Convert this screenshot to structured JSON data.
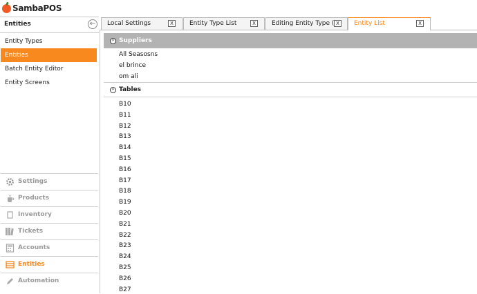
{
  "app": {
    "logo_text": "SambaPOS"
  },
  "sidebar": {
    "header_title": "Entities",
    "back_icon": "arrow-left-icon",
    "items": [
      {
        "label": "Entity Types",
        "active": false
      },
      {
        "label": "Entities",
        "active": true
      },
      {
        "label": "Batch Entity Editor",
        "active": false
      },
      {
        "label": "Entity Screens",
        "active": false
      }
    ],
    "nav": [
      {
        "label": "Settings",
        "icon": "gear-icon",
        "active": false
      },
      {
        "label": "Products",
        "icon": "cup-icon",
        "active": false
      },
      {
        "label": "Inventory",
        "icon": "box-icon",
        "active": false
      },
      {
        "label": "Tickets",
        "icon": "books-icon",
        "active": false
      },
      {
        "label": "Accounts",
        "icon": "calculator-icon",
        "active": false
      },
      {
        "label": "Entities",
        "icon": "table-icon",
        "active": true
      },
      {
        "label": "Automation",
        "icon": "pencil-icon",
        "active": false
      }
    ]
  },
  "tabs": [
    {
      "label": "Local Settings",
      "close": "X",
      "active": false
    },
    {
      "label": "Entity Type List",
      "close": "X",
      "active": false
    },
    {
      "label": "Editing Entity Type (Su",
      "close": "X",
      "active": false
    },
    {
      "label": "Entity List",
      "close": "X",
      "active": true
    }
  ],
  "groups": [
    {
      "title": "Suppliers",
      "expand_icon": "chevron-circle-icon",
      "items": [
        "All Seasosns",
        "el brince",
        "om ali"
      ]
    },
    {
      "title": "Tables",
      "expand_icon": "chevron-circle-icon",
      "items": [
        "B10",
        "B11",
        "B12",
        "B13",
        "B14",
        "B15",
        "B16",
        "B17",
        "B18",
        "B19",
        "B20",
        "B21",
        "B22",
        "B23",
        "B24",
        "B25",
        "B26",
        "B27"
      ]
    }
  ],
  "colors": {
    "accent": "#f7891f",
    "group_header_bg": "#b3b3b3",
    "logo": "#f15a24"
  }
}
